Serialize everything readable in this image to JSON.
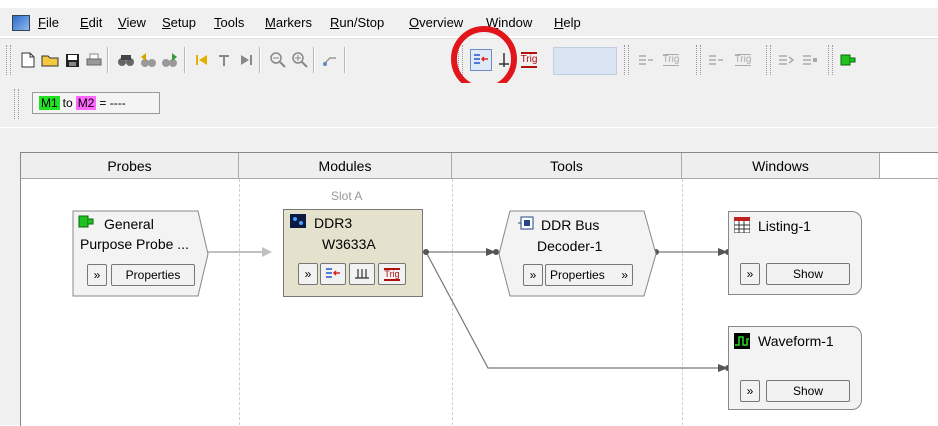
{
  "menu": [
    "File",
    "Edit",
    "View",
    "Setup",
    "Tools",
    "Markers",
    "Run/Stop",
    "Overview",
    "Window",
    "Help"
  ],
  "menu_underline": [
    "F",
    "E",
    "V",
    "S",
    "T",
    "M",
    "R",
    "O",
    "W",
    "H"
  ],
  "toolbar": {
    "trig_label": "Trig",
    "trig_label_gray": "Trig"
  },
  "markers": {
    "m1": "M1",
    "to": "to",
    "m2": "M2",
    "eq": "= ----"
  },
  "columns": [
    "Probes",
    "Modules",
    "Tools",
    "Windows"
  ],
  "slot_label": "Slot A",
  "probe": {
    "title_line1": "General",
    "title_line2": "Purpose Probe ...",
    "properties": "Properties"
  },
  "module": {
    "title_line1": "DDR3",
    "title_line2": "W3633A",
    "trig": "Trig"
  },
  "tool": {
    "title_line1": "DDR Bus",
    "title_line2": "Decoder-1",
    "properties": "Properties"
  },
  "windows": [
    {
      "title": "Listing-1",
      "show": "Show"
    },
    {
      "title": "Waveform-1",
      "show": "Show"
    }
  ],
  "colors": {
    "highlight_circle": "#e0161b",
    "m1": "#22e022",
    "m2": "#ff66ff",
    "module_bg": "#e4e2cc"
  },
  "chevron_glyph": "»"
}
